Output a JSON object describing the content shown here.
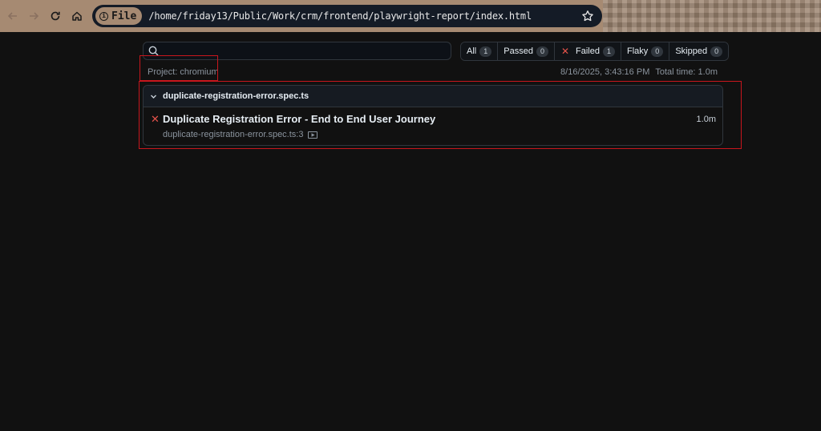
{
  "browser": {
    "file_chip": "File",
    "url": "/home/friday13/Public/Work/crm/frontend/playwright-report/index.html"
  },
  "search": {
    "placeholder": ""
  },
  "filters": [
    {
      "label": "All",
      "count": "1"
    },
    {
      "label": "Passed",
      "count": "0"
    },
    {
      "label": "Failed",
      "count": "1"
    },
    {
      "label": "Flaky",
      "count": "0"
    },
    {
      "label": "Skipped",
      "count": "0"
    }
  ],
  "report": {
    "project": "Project: chromium",
    "timestamp": "8/16/2025, 3:43:16 PM",
    "total_time": "Total time: 1.0m"
  },
  "file": {
    "name": "duplicate-registration-error.spec.ts",
    "tests": [
      {
        "title": "Duplicate Registration Error - End to End User Journey",
        "location": "duplicate-registration-error.spec.ts:3",
        "duration": "1.0m",
        "status": "failed"
      }
    ]
  },
  "colors": {
    "failed": "#e5534b",
    "highlight": "#c8161d",
    "toolbar": "#a68a72"
  }
}
